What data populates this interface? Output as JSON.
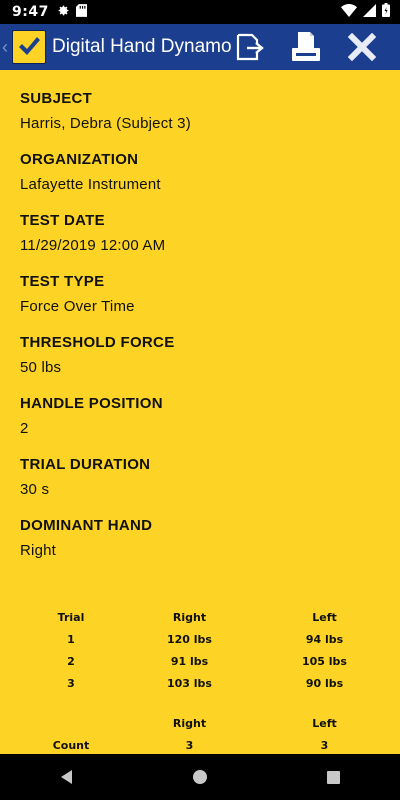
{
  "status_bar": {
    "time": "9:47",
    "left_icons": [
      "gear-icon",
      "sd-card-icon"
    ],
    "right_icons": [
      "wifi-icon",
      "signal-icon",
      "battery-icon"
    ]
  },
  "app_bar": {
    "title": "Digital Hand Dynamo…",
    "logo_icon": "checkmark-logo-icon",
    "actions": [
      "export-icon",
      "print-icon",
      "close-icon"
    ],
    "colors": {
      "background": "#1b3e8f",
      "logo_bg": "#fdd426"
    }
  },
  "fields": [
    {
      "label": "SUBJECT",
      "value": "Harris, Debra (Subject 3)"
    },
    {
      "label": "ORGANIZATION",
      "value": "Lafayette Instrument"
    },
    {
      "label": "TEST DATE",
      "value": "11/29/2019 12:00 AM"
    },
    {
      "label": "TEST TYPE",
      "value": "Force Over Time"
    },
    {
      "label": "THRESHOLD FORCE",
      "value": "50 lbs"
    },
    {
      "label": "HANDLE POSITION",
      "value": "2"
    },
    {
      "label": "TRIAL DURATION",
      "value": "30 s"
    },
    {
      "label": "DOMINANT HAND",
      "value": "Right"
    }
  ],
  "results_table": {
    "headers": [
      "Trial",
      "Right",
      "Left"
    ],
    "rows": [
      [
        "1",
        "120 lbs",
        "94 lbs"
      ],
      [
        "2",
        "91 lbs",
        "105 lbs"
      ],
      [
        "3",
        "103 lbs",
        "90 lbs"
      ]
    ]
  },
  "summary_table": {
    "headers": [
      "",
      "Right",
      "Left"
    ],
    "rows": [
      [
        "Count",
        "3",
        "3"
      ]
    ]
  },
  "nav_bar": {
    "buttons": [
      "back-icon",
      "home-icon",
      "recents-icon"
    ]
  },
  "colors": {
    "page_background": "#fdd426",
    "text": "#111111"
  }
}
